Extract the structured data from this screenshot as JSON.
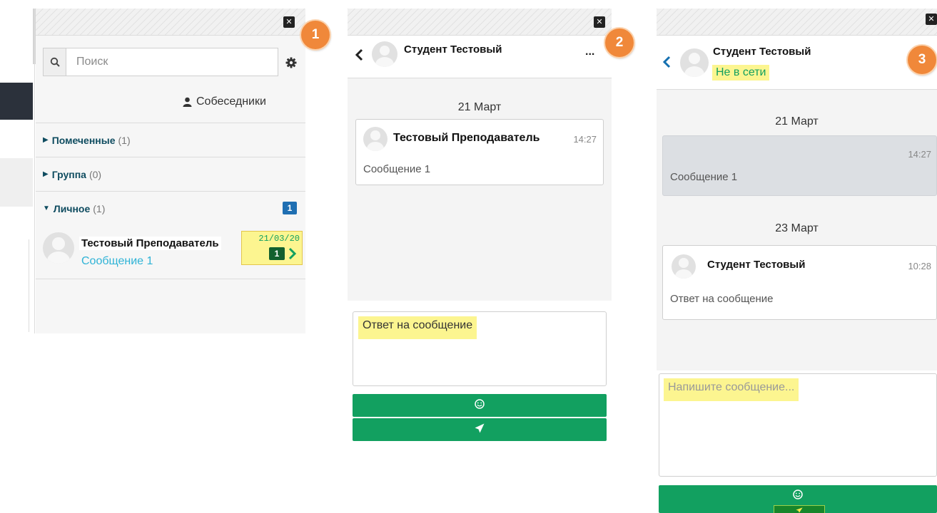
{
  "colors": {
    "accent_green": "#12a060",
    "badge_orange": "#f0883a",
    "highlight_yellow": "#fcf590",
    "unread_blue": "#1f6fb2",
    "link_cyan": "#2fb3d6"
  },
  "panel1": {
    "badge": "1",
    "search": {
      "placeholder": "Поиск",
      "value": ""
    },
    "contacts_link": "Собеседники",
    "sections": [
      {
        "label": "Помеченные",
        "count": "(1)"
      },
      {
        "label": "Группа",
        "count": "(0)"
      },
      {
        "label": "Личное",
        "count": "(1)",
        "unread": "1"
      }
    ],
    "conversation": {
      "name": "Тестовый Преподаватель",
      "last_message": "Сообщение 1",
      "date": "21/03/20",
      "unread": "1"
    },
    "icons": [
      "close-icon",
      "search-icon",
      "gear-icon",
      "user-icon",
      "caret-right-icon",
      "caret-down-icon",
      "chevron-right-icon"
    ]
  },
  "panel2": {
    "badge": "2",
    "header": {
      "title": "Студент Тестовый",
      "more": "..."
    },
    "date_separator": "21 Март",
    "message": {
      "author": "Тестовый Преподаватель",
      "time": "14:27",
      "text": "Сообщение 1"
    },
    "reply_text": "Ответ на сообщение",
    "icons": [
      "back-icon",
      "emoji-icon",
      "send-icon"
    ]
  },
  "panel3": {
    "badge": "3",
    "header": {
      "title": "Студент Тестовый",
      "status": "Не в сети"
    },
    "date_separator_1": "21 Март",
    "message_1": {
      "time": "14:27",
      "text": "Сообщение 1"
    },
    "date_separator_2": "23 Март",
    "message_2": {
      "author": "Студент Тестовый",
      "time": "10:28",
      "text": "Ответ на сообщение"
    },
    "input_placeholder": "Напишите сообщение...",
    "icons": [
      "back-icon",
      "emoji-icon",
      "send-icon"
    ]
  }
}
